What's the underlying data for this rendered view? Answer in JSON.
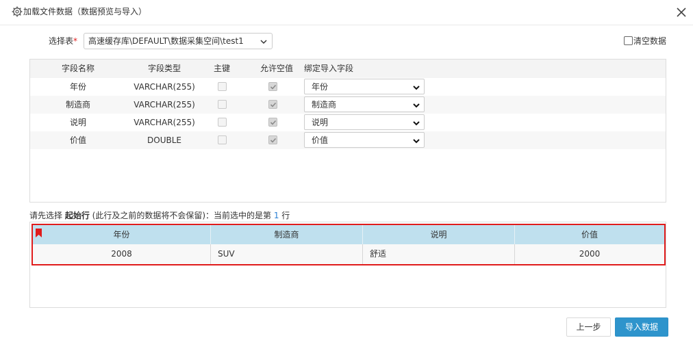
{
  "dialog": {
    "title": "加载文件数据（数据预览与导入）",
    "title_icon": "gear-icon",
    "close_icon": "close-icon"
  },
  "table_select": {
    "label": "选择表",
    "required_mark": "*",
    "value": "高速缓存库\\DEFAULT\\数据采集空间\\test1"
  },
  "clear_data": {
    "label": "清空数据",
    "checked": false
  },
  "fields": {
    "headers": [
      "字段名称",
      "字段类型",
      "主键",
      "允许空值",
      "绑定导入字段"
    ],
    "rows": [
      {
        "name": "年份",
        "type": "VARCHAR(255)",
        "primary_key": false,
        "nullable": true,
        "bind": "年份"
      },
      {
        "name": "制造商",
        "type": "VARCHAR(255)",
        "primary_key": false,
        "nullable": true,
        "bind": "制造商"
      },
      {
        "name": "说明",
        "type": "VARCHAR(255)",
        "primary_key": false,
        "nullable": true,
        "bind": "说明"
      },
      {
        "name": "价值",
        "type": "DOUBLE",
        "primary_key": false,
        "nullable": true,
        "bind": "价值"
      }
    ]
  },
  "hint": {
    "prefix": "请先选择 ",
    "bold": "起始行",
    "middle": " (此行及之前的数据将不会保留)：当前选中的是第 ",
    "row_number": "1",
    "suffix": " 行"
  },
  "preview": {
    "headers": [
      "年份",
      "制造商",
      "说明",
      "价值"
    ],
    "rows": [
      [
        "2008",
        "SUV",
        "舒适",
        "2000"
      ]
    ],
    "marker_icon": "bookmark-icon",
    "highlight_color": "#e01b1b",
    "header_color": "#bfe0ee"
  },
  "buttons": {
    "prev": "上一步",
    "import": "导入数据"
  },
  "colors": {
    "primary": "#2e94cc",
    "accent_number": "#2a7fd4"
  }
}
